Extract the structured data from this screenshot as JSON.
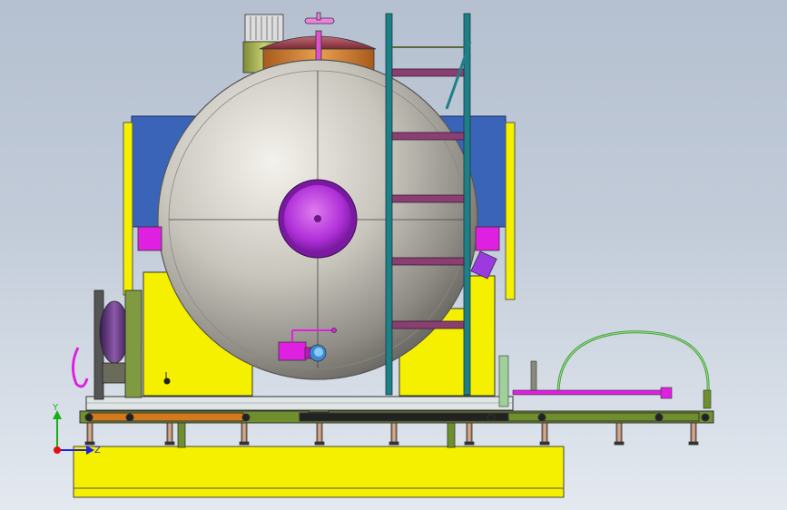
{
  "axes": {
    "y_label": "Y",
    "z_label": "Z",
    "colors": {
      "y": "#16b016",
      "z": "#2020e0",
      "origin": "#e01010"
    }
  },
  "colors": {
    "background": "#c2ccd9",
    "tank_body": "#b8b5ad",
    "blue_panel": "#3a64b8",
    "yellow_frame": "#f4f000",
    "purple_flange": "#a020d0",
    "magenta_piping": "#e020e0",
    "ladder": "#1f7f86",
    "ladder_rungs": "#8a3f72",
    "skid_green": "#6f8f2e",
    "orange_rail": "#d47a1a",
    "manway_dome": "#9a3a48",
    "copper_band": "#c77a2e",
    "vent_green": "#a8b45a",
    "hose": "#4aa040"
  }
}
